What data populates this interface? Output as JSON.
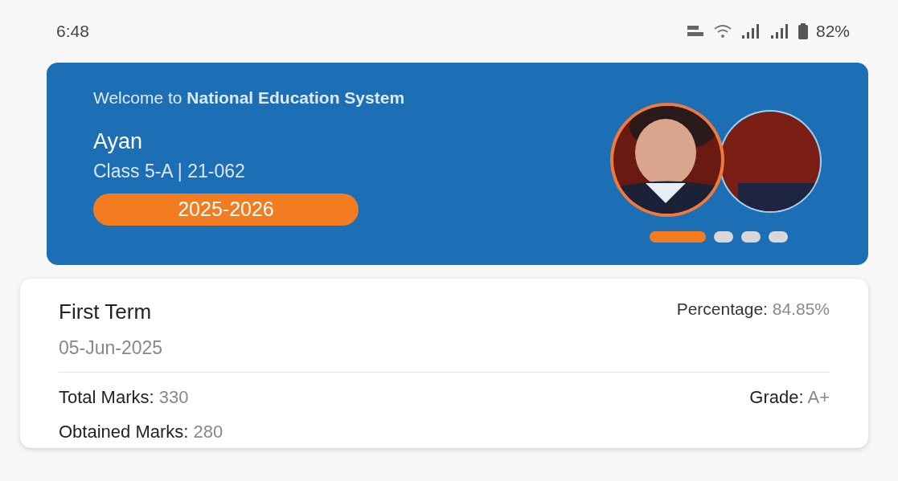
{
  "status_bar": {
    "time": "6:48",
    "battery": "82%"
  },
  "banner": {
    "welcome": "Welcome to **National Education System**",
    "name": "Ayan",
    "class_info": "Class 5-A | 21-062",
    "session": "2025-2026",
    "dots": [
      {
        "selected": true
      },
      {
        "selected": false
      },
      {
        "selected": false
      },
      {
        "selected": false
      }
    ]
  },
  "result": {
    "term": "First Term",
    "date": "05-Jun-2025",
    "percentage": {
      "label": "Percentage:",
      "value": "84.85%"
    },
    "total": {
      "label": "Total Marks:",
      "value": "330"
    },
    "grade": {
      "label": "Grade:",
      "value": "A+"
    },
    "obtained": {
      "label": "Obtained Marks:",
      "value": "280"
    }
  }
}
